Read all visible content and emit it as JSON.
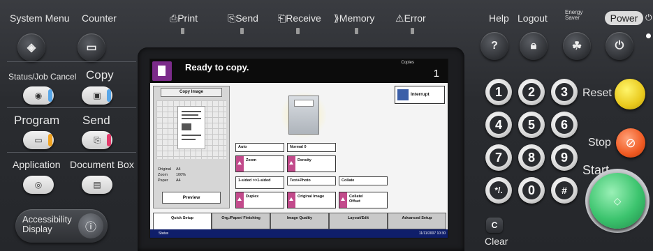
{
  "top_bar": {
    "system_menu": "System Menu",
    "counter": "Counter",
    "print": "Print",
    "send": "Send",
    "receive": "Receive",
    "memory": "Memory",
    "error": "Error",
    "help": "Help",
    "logout": "Logout",
    "energy_saver": "Energy Saver",
    "power": "Power",
    "icons": {
      "print": "printer-icon",
      "send": "send-icon",
      "receive": "receive-icon",
      "memory": "memory-icon",
      "error": "warning-icon"
    }
  },
  "left_panel": {
    "status_job_cancel": "Status/Job Cancel",
    "copy": "Copy",
    "program": "Program",
    "send": "Send",
    "application": "Application",
    "document_box": "Document Box",
    "accessibility_display": "Accessibility Display"
  },
  "screen": {
    "title": "Ready to copy.",
    "copies_label": "Copies",
    "copies": "1",
    "copy_image": "Copy Image",
    "original_label": "Original",
    "original_value": "A4",
    "zoom_label": "Zoom",
    "zoom_value": "100%",
    "paper_label": "Paper",
    "paper_value": "A4",
    "preview": "Preview",
    "interrupt": "Interrupt",
    "functions": [
      {
        "label": "Auto",
        "button": "Zoom"
      },
      {
        "label": "Normal 0",
        "button": "Density"
      },
      {
        "label": "1-sided >>1-sided",
        "button": "Duplex"
      },
      {
        "label": "Text+Photo",
        "button": "Original Image"
      },
      {
        "label": "Collate",
        "button": "Collate/ Offset"
      }
    ],
    "tabs": [
      "Quick Setup",
      "Org./Paper/ Finishing",
      "Image Quality",
      "Layout/Edit",
      "Advanced Setup"
    ],
    "status": "Status",
    "datetime": "11/11/2007 10:30"
  },
  "keypad": {
    "keys": [
      "1",
      "2",
      "3",
      "4",
      "5",
      "6",
      "7",
      "8",
      "9",
      "*/.",
      "0",
      "#"
    ],
    "reset": "Reset",
    "stop": "Stop",
    "start": "Start",
    "clear": "Clear"
  },
  "colors": {
    "accent_purple": "#7b2b8a",
    "status_blue": "#0f1e6a",
    "reset_yellow": "#e9c91d",
    "stop_orange": "#f05a22",
    "start_green": "#3cc46e"
  }
}
